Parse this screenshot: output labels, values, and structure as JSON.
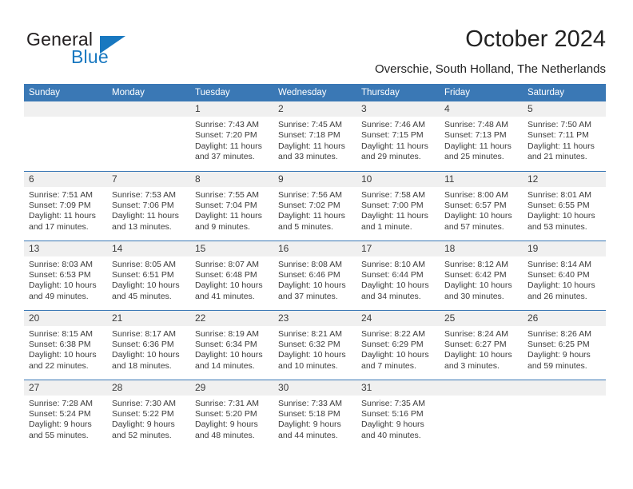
{
  "brand": {
    "name_part1": "General",
    "name_part2": "Blue",
    "accent_color": "#1878c0",
    "triangle_icon": "triangle-icon"
  },
  "header": {
    "title": "October 2024",
    "subtitle": "Overschie, South Holland, The Netherlands"
  },
  "theme": {
    "header_blue": "#3a78b5",
    "daynum_band": "#f0f0f0",
    "text": "#3c3c3c"
  },
  "weekdays": [
    "Sunday",
    "Monday",
    "Tuesday",
    "Wednesday",
    "Thursday",
    "Friday",
    "Saturday"
  ],
  "weeks": [
    [
      {
        "day": "",
        "sunrise": "",
        "sunset": "",
        "daylight1": "",
        "daylight2": ""
      },
      {
        "day": "",
        "sunrise": "",
        "sunset": "",
        "daylight1": "",
        "daylight2": ""
      },
      {
        "day": "1",
        "sunrise": "Sunrise: 7:43 AM",
        "sunset": "Sunset: 7:20 PM",
        "daylight1": "Daylight: 11 hours",
        "daylight2": "and 37 minutes."
      },
      {
        "day": "2",
        "sunrise": "Sunrise: 7:45 AM",
        "sunset": "Sunset: 7:18 PM",
        "daylight1": "Daylight: 11 hours",
        "daylight2": "and 33 minutes."
      },
      {
        "day": "3",
        "sunrise": "Sunrise: 7:46 AM",
        "sunset": "Sunset: 7:15 PM",
        "daylight1": "Daylight: 11 hours",
        "daylight2": "and 29 minutes."
      },
      {
        "day": "4",
        "sunrise": "Sunrise: 7:48 AM",
        "sunset": "Sunset: 7:13 PM",
        "daylight1": "Daylight: 11 hours",
        "daylight2": "and 25 minutes."
      },
      {
        "day": "5",
        "sunrise": "Sunrise: 7:50 AM",
        "sunset": "Sunset: 7:11 PM",
        "daylight1": "Daylight: 11 hours",
        "daylight2": "and 21 minutes."
      }
    ],
    [
      {
        "day": "6",
        "sunrise": "Sunrise: 7:51 AM",
        "sunset": "Sunset: 7:09 PM",
        "daylight1": "Daylight: 11 hours",
        "daylight2": "and 17 minutes."
      },
      {
        "day": "7",
        "sunrise": "Sunrise: 7:53 AM",
        "sunset": "Sunset: 7:06 PM",
        "daylight1": "Daylight: 11 hours",
        "daylight2": "and 13 minutes."
      },
      {
        "day": "8",
        "sunrise": "Sunrise: 7:55 AM",
        "sunset": "Sunset: 7:04 PM",
        "daylight1": "Daylight: 11 hours",
        "daylight2": "and 9 minutes."
      },
      {
        "day": "9",
        "sunrise": "Sunrise: 7:56 AM",
        "sunset": "Sunset: 7:02 PM",
        "daylight1": "Daylight: 11 hours",
        "daylight2": "and 5 minutes."
      },
      {
        "day": "10",
        "sunrise": "Sunrise: 7:58 AM",
        "sunset": "Sunset: 7:00 PM",
        "daylight1": "Daylight: 11 hours",
        "daylight2": "and 1 minute."
      },
      {
        "day": "11",
        "sunrise": "Sunrise: 8:00 AM",
        "sunset": "Sunset: 6:57 PM",
        "daylight1": "Daylight: 10 hours",
        "daylight2": "and 57 minutes."
      },
      {
        "day": "12",
        "sunrise": "Sunrise: 8:01 AM",
        "sunset": "Sunset: 6:55 PM",
        "daylight1": "Daylight: 10 hours",
        "daylight2": "and 53 minutes."
      }
    ],
    [
      {
        "day": "13",
        "sunrise": "Sunrise: 8:03 AM",
        "sunset": "Sunset: 6:53 PM",
        "daylight1": "Daylight: 10 hours",
        "daylight2": "and 49 minutes."
      },
      {
        "day": "14",
        "sunrise": "Sunrise: 8:05 AM",
        "sunset": "Sunset: 6:51 PM",
        "daylight1": "Daylight: 10 hours",
        "daylight2": "and 45 minutes."
      },
      {
        "day": "15",
        "sunrise": "Sunrise: 8:07 AM",
        "sunset": "Sunset: 6:48 PM",
        "daylight1": "Daylight: 10 hours",
        "daylight2": "and 41 minutes."
      },
      {
        "day": "16",
        "sunrise": "Sunrise: 8:08 AM",
        "sunset": "Sunset: 6:46 PM",
        "daylight1": "Daylight: 10 hours",
        "daylight2": "and 37 minutes."
      },
      {
        "day": "17",
        "sunrise": "Sunrise: 8:10 AM",
        "sunset": "Sunset: 6:44 PM",
        "daylight1": "Daylight: 10 hours",
        "daylight2": "and 34 minutes."
      },
      {
        "day": "18",
        "sunrise": "Sunrise: 8:12 AM",
        "sunset": "Sunset: 6:42 PM",
        "daylight1": "Daylight: 10 hours",
        "daylight2": "and 30 minutes."
      },
      {
        "day": "19",
        "sunrise": "Sunrise: 8:14 AM",
        "sunset": "Sunset: 6:40 PM",
        "daylight1": "Daylight: 10 hours",
        "daylight2": "and 26 minutes."
      }
    ],
    [
      {
        "day": "20",
        "sunrise": "Sunrise: 8:15 AM",
        "sunset": "Sunset: 6:38 PM",
        "daylight1": "Daylight: 10 hours",
        "daylight2": "and 22 minutes."
      },
      {
        "day": "21",
        "sunrise": "Sunrise: 8:17 AM",
        "sunset": "Sunset: 6:36 PM",
        "daylight1": "Daylight: 10 hours",
        "daylight2": "and 18 minutes."
      },
      {
        "day": "22",
        "sunrise": "Sunrise: 8:19 AM",
        "sunset": "Sunset: 6:34 PM",
        "daylight1": "Daylight: 10 hours",
        "daylight2": "and 14 minutes."
      },
      {
        "day": "23",
        "sunrise": "Sunrise: 8:21 AM",
        "sunset": "Sunset: 6:32 PM",
        "daylight1": "Daylight: 10 hours",
        "daylight2": "and 10 minutes."
      },
      {
        "day": "24",
        "sunrise": "Sunrise: 8:22 AM",
        "sunset": "Sunset: 6:29 PM",
        "daylight1": "Daylight: 10 hours",
        "daylight2": "and 7 minutes."
      },
      {
        "day": "25",
        "sunrise": "Sunrise: 8:24 AM",
        "sunset": "Sunset: 6:27 PM",
        "daylight1": "Daylight: 10 hours",
        "daylight2": "and 3 minutes."
      },
      {
        "day": "26",
        "sunrise": "Sunrise: 8:26 AM",
        "sunset": "Sunset: 6:25 PM",
        "daylight1": "Daylight: 9 hours",
        "daylight2": "and 59 minutes."
      }
    ],
    [
      {
        "day": "27",
        "sunrise": "Sunrise: 7:28 AM",
        "sunset": "Sunset: 5:24 PM",
        "daylight1": "Daylight: 9 hours",
        "daylight2": "and 55 minutes."
      },
      {
        "day": "28",
        "sunrise": "Sunrise: 7:30 AM",
        "sunset": "Sunset: 5:22 PM",
        "daylight1": "Daylight: 9 hours",
        "daylight2": "and 52 minutes."
      },
      {
        "day": "29",
        "sunrise": "Sunrise: 7:31 AM",
        "sunset": "Sunset: 5:20 PM",
        "daylight1": "Daylight: 9 hours",
        "daylight2": "and 48 minutes."
      },
      {
        "day": "30",
        "sunrise": "Sunrise: 7:33 AM",
        "sunset": "Sunset: 5:18 PM",
        "daylight1": "Daylight: 9 hours",
        "daylight2": "and 44 minutes."
      },
      {
        "day": "31",
        "sunrise": "Sunrise: 7:35 AM",
        "sunset": "Sunset: 5:16 PM",
        "daylight1": "Daylight: 9 hours",
        "daylight2": "and 40 minutes."
      },
      {
        "day": "",
        "sunrise": "",
        "sunset": "",
        "daylight1": "",
        "daylight2": ""
      },
      {
        "day": "",
        "sunrise": "",
        "sunset": "",
        "daylight1": "",
        "daylight2": ""
      }
    ]
  ]
}
